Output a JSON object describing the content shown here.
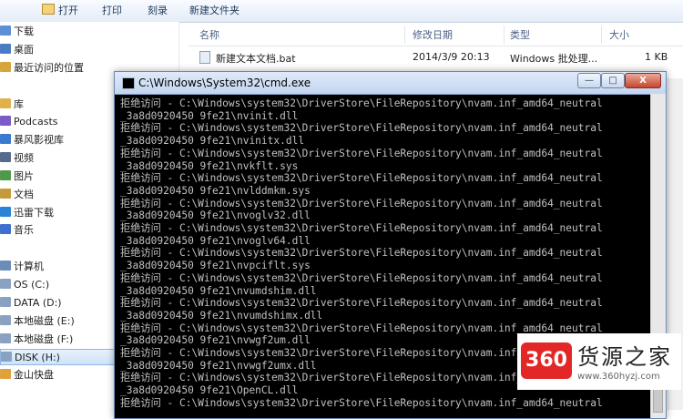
{
  "explorer": {
    "toolbar": [
      "打开",
      "打印",
      "刻录",
      "新建文件夹"
    ],
    "nav": [
      {
        "label": "下载",
        "color": "#5b8fd6"
      },
      {
        "label": "桌面",
        "color": "#4a7cc4"
      },
      {
        "label": "最近访问的位置",
        "color": "#d8a53c"
      },
      {
        "label": "库",
        "color": "#e0b04a"
      },
      {
        "label": "Podcasts",
        "color": "#7b5cc7"
      },
      {
        "label": "暴风影视库",
        "color": "#3b7ad1"
      },
      {
        "label": "视频",
        "color": "#556b8e"
      },
      {
        "label": "图片",
        "color": "#4e9a4a"
      },
      {
        "label": "文档",
        "color": "#c69a3b"
      },
      {
        "label": "迅雷下载",
        "color": "#2c82d6"
      },
      {
        "label": "音乐",
        "color": "#3f6fd0"
      },
      {
        "label": "计算机",
        "color": "#6c8db8"
      },
      {
        "label": "OS (C:)",
        "color": "#8aa2c2"
      },
      {
        "label": "DATA (D:)",
        "color": "#8aa2c2"
      },
      {
        "label": "本地磁盘 (E:)",
        "color": "#8aa2c2"
      },
      {
        "label": "本地磁盘 (F:)",
        "color": "#8aa2c2"
      },
      {
        "label": "DISK (H:)",
        "color": "#8aa2c2"
      },
      {
        "label": "金山快盘",
        "color": "#e0a03a"
      }
    ],
    "columns": [
      "名称",
      "修改日期",
      "类型",
      "大小"
    ],
    "file": {
      "name": "新建文本文档.bat",
      "date": "2014/3/9 20:13",
      "type": "Windows 批处理...",
      "size": "1 KB"
    }
  },
  "cmd": {
    "title": "C:\\Windows\\System32\\cmd.exe",
    "buttons": {
      "minimize": "—",
      "maximize": "□",
      "close": "X"
    },
    "lines": [
      "拒绝访问 - C:\\Windows\\system32\\DriverStore\\FileRepository\\nvam.inf_amd64_neutral",
      "_3a8d0920450 9fe21\\nvinit.dll",
      "拒绝访问 - C:\\Windows\\system32\\DriverStore\\FileRepository\\nvam.inf_amd64_neutral",
      "_3a8d0920450 9fe21\\nvinitx.dll",
      "拒绝访问 - C:\\Windows\\system32\\DriverStore\\FileRepository\\nvam.inf_amd64_neutral",
      "_3a8d0920450 9fe21\\nvkflt.sys",
      "拒绝访问 - C:\\Windows\\system32\\DriverStore\\FileRepository\\nvam.inf_amd64_neutral",
      "_3a8d0920450 9fe21\\nvlddmkm.sys",
      "拒绝访问 - C:\\Windows\\system32\\DriverStore\\FileRepository\\nvam.inf_amd64_neutral",
      "_3a8d0920450 9fe21\\nvoglv32.dll",
      "拒绝访问 - C:\\Windows\\system32\\DriverStore\\FileRepository\\nvam.inf_amd64_neutral",
      "_3a8d0920450 9fe21\\nvoglv64.dll",
      "拒绝访问 - C:\\Windows\\system32\\DriverStore\\FileRepository\\nvam.inf_amd64_neutral",
      "_3a8d0920450 9fe21\\nvpciflt.sys",
      "拒绝访问 - C:\\Windows\\system32\\DriverStore\\FileRepository\\nvam.inf_amd64_neutral",
      "_3a8d0920450 9fe21\\nvumdshim.dll",
      "拒绝访问 - C:\\Windows\\system32\\DriverStore\\FileRepository\\nvam.inf_amd64_neutral",
      "_3a8d0920450 9fe21\\nvumdshimx.dll",
      "拒绝访问 - C:\\Windows\\system32\\DriverStore\\FileRepository\\nvam.inf_amd64_neutral",
      "_3a8d0920450 9fe21\\nvwgf2um.dll",
      "拒绝访问 - C:\\Windows\\system32\\DriverStore\\FileRepository\\nvam.inf_amd64_neutral",
      "_3a8d0920450 9fe21\\nvwgf2umx.dll",
      "拒绝访问 - C:\\Windows\\system32\\DriverStore\\FileRepository\\nvam.inf_amd64_neutral",
      "_3a8d0920450 9fe21\\OpenCL.dll",
      "拒绝访问 - C:\\Windows\\system32\\DriverStore\\FileRepository\\nvam.inf_amd64_neutral"
    ]
  },
  "watermark": {
    "logo": "360",
    "name": "货源之家",
    "url": "www.360hyzj.com"
  }
}
